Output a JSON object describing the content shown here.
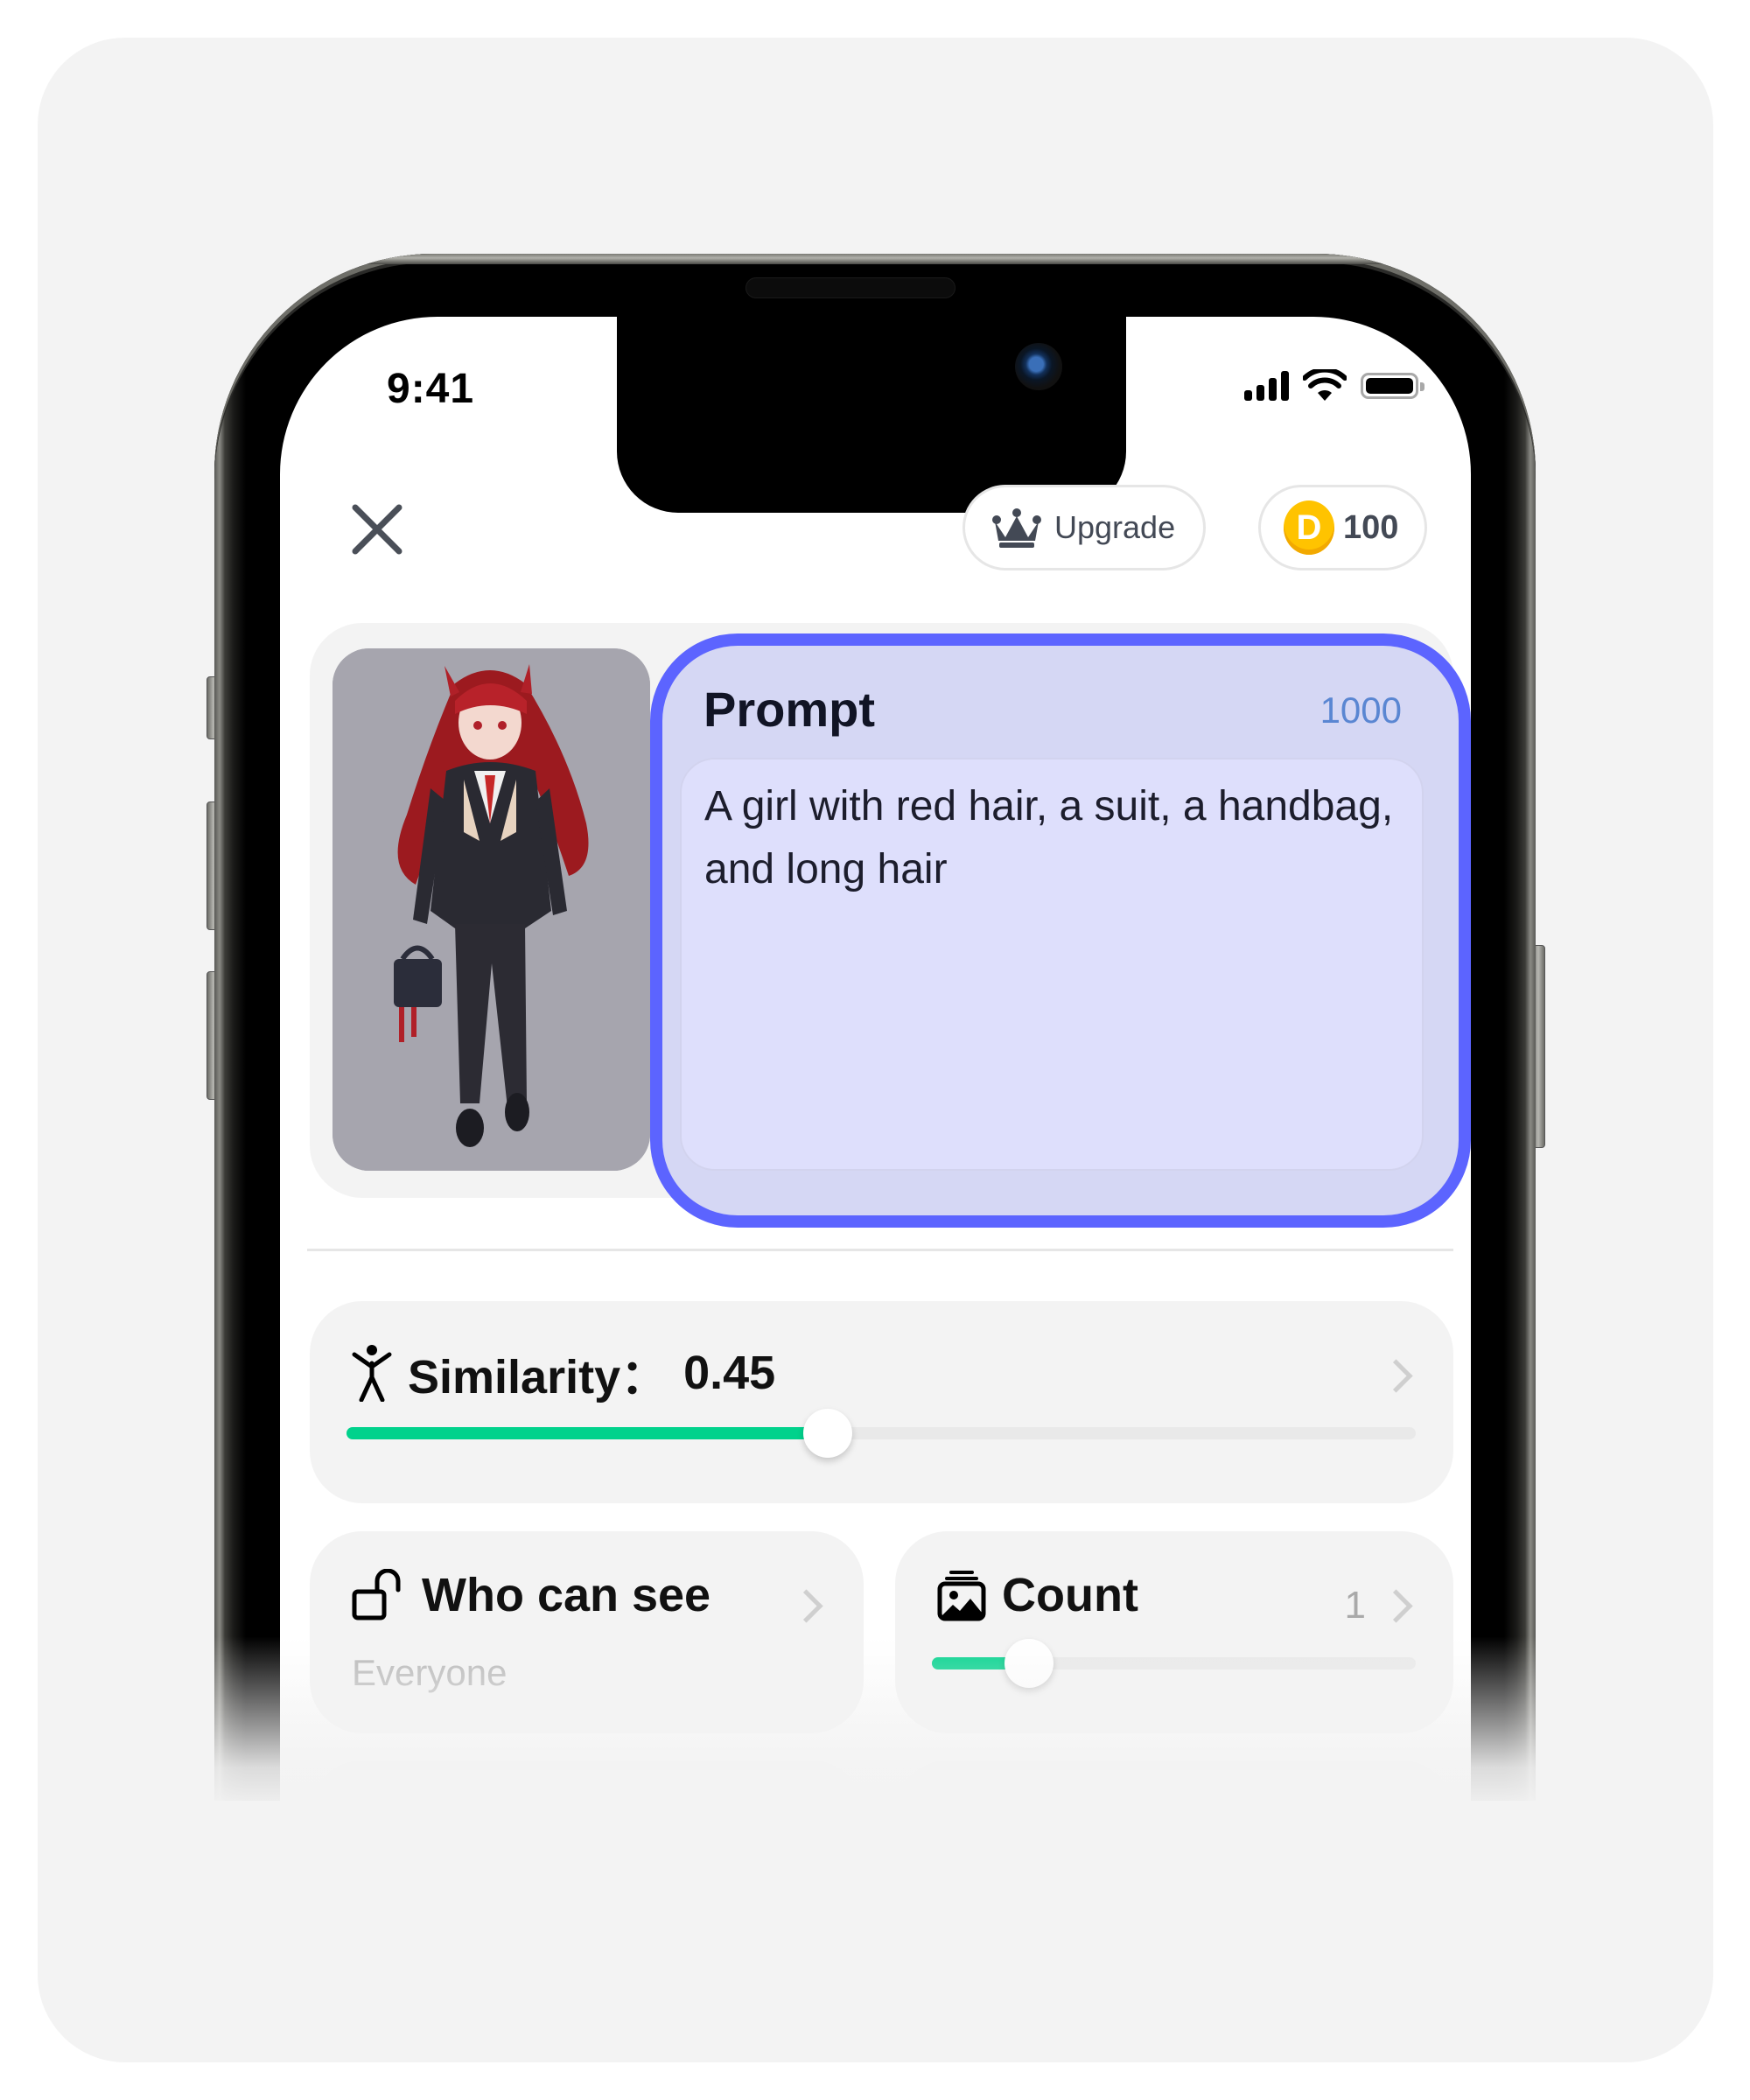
{
  "status_bar": {
    "time": "9:41",
    "icons": [
      "signal-icon",
      "wifi-icon",
      "battery-icon"
    ]
  },
  "header": {
    "close_icon": "close-icon",
    "upgrade_label": "Upgrade",
    "upgrade_icon": "crown-icon",
    "coin_icon_letter": "D",
    "coin_balance": "100"
  },
  "reference_image": {
    "alt": "Anime girl with long red hair in a black suit holding a handbag"
  },
  "prompt": {
    "title": "Prompt",
    "char_limit": "1000",
    "value": "A girl with red hair, a suit, a handbag, and long hair"
  },
  "similarity": {
    "label": "Similarity：",
    "value": "0.45",
    "slider_fraction": 0.45
  },
  "visibility": {
    "label": "Who can see",
    "value": "Everyone"
  },
  "count": {
    "label": "Count",
    "value": "1",
    "slider_fraction": 0.2
  },
  "colors": {
    "accent_border": "#5c64ff",
    "slider_fill": "#00d28c",
    "coin": "#ffc300",
    "char_count": "#5a86d2"
  }
}
